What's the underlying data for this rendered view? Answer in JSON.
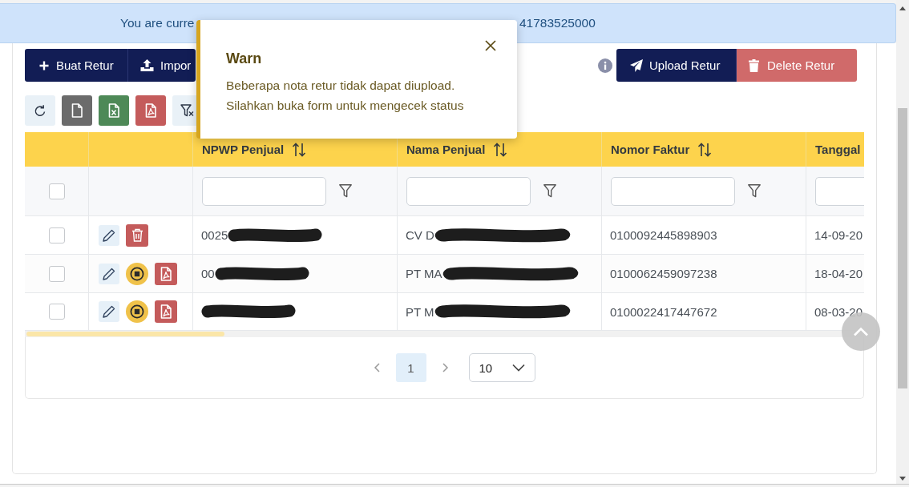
{
  "banner": {
    "text_start": "You are curre",
    "text_end": "41783525000"
  },
  "toolbar": {
    "left_buttons": [
      {
        "kind": "add",
        "label": "Buat Retur"
      },
      {
        "kind": "import",
        "label": "Impor"
      }
    ],
    "info_icon": true,
    "right_buttons": [
      {
        "kind": "upload",
        "label": "Upload Retur"
      },
      {
        "kind": "delete",
        "label": "Delete Retur"
      }
    ],
    "icon_buttons": [
      {
        "kind": "refresh"
      },
      {
        "kind": "file"
      },
      {
        "kind": "excel"
      },
      {
        "kind": "pdf"
      },
      {
        "kind": "clear_filter"
      }
    ]
  },
  "table": {
    "select_all": {
      "checked": false
    },
    "columns": [
      {
        "label": "NPWP Penjual",
        "sortable": true
      },
      {
        "label": "Nama Penjual",
        "sortable": true
      },
      {
        "label": "Nomor Faktur",
        "sortable": true
      },
      {
        "label": "Tanggal",
        "sortable": false
      }
    ],
    "rows": [
      {
        "checked": false,
        "actions": [
          {
            "kind": "edit"
          },
          {
            "kind": "delete"
          }
        ],
        "cells": [
          {
            "text": "0025",
            "redacted": true
          },
          {
            "text": "CV D",
            "redacted": true
          },
          {
            "text": "0100092445898903",
            "redacted": false
          },
          {
            "text": "14-09-20",
            "redacted": false
          }
        ]
      },
      {
        "checked": false,
        "actions": [
          {
            "kind": "edit"
          },
          {
            "kind": "stop"
          },
          {
            "kind": "pdf"
          }
        ],
        "cells": [
          {
            "text": "00",
            "redacted": true
          },
          {
            "text": "PT MA",
            "redacted": true
          },
          {
            "text": "0100062459097238",
            "redacted": false
          },
          {
            "text": "18-04-20",
            "redacted": false
          }
        ]
      },
      {
        "checked": false,
        "actions": [
          {
            "kind": "edit"
          },
          {
            "kind": "stop"
          },
          {
            "kind": "pdf"
          }
        ],
        "cells": [
          {
            "redacted": true
          },
          {
            "text": "PT M",
            "redacted": true
          },
          {
            "text": "0100022417447672",
            "redacted": false
          },
          {
            "text": "08-03-20",
            "redacted": false
          }
        ]
      }
    ]
  },
  "pagination": {
    "pages": [
      {
        "label": "1",
        "selected": true
      }
    ],
    "page_size": "10"
  },
  "toast": {
    "kind": "warn",
    "title": "Warn",
    "message": "Beberapa nota retur tidak dapat diupload. Silahkan buka form untuk mengecek status"
  }
}
